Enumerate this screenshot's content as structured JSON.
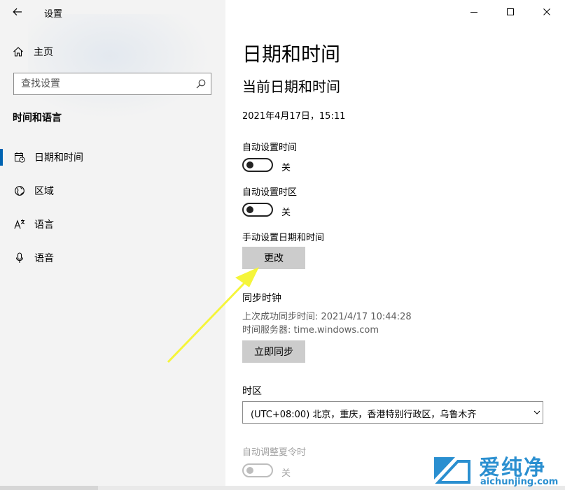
{
  "app": {
    "title": "设置"
  },
  "sidebar": {
    "home_label": "主页",
    "search_placeholder": "查找设置",
    "section_title": "时间和语言",
    "items": [
      {
        "label": "日期和时间",
        "icon": "calendar-clock-icon",
        "active": true
      },
      {
        "label": "区域",
        "icon": "globe-icon",
        "active": false
      },
      {
        "label": "语言",
        "icon": "language-icon",
        "active": false
      },
      {
        "label": "语音",
        "icon": "microphone-icon",
        "active": false
      }
    ]
  },
  "main": {
    "page_title": "日期和时间",
    "subtitle": "当前日期和时间",
    "current_datetime": "2021年4月17日，15:11",
    "auto_time": {
      "label": "自动设置时间",
      "state_text": "关"
    },
    "auto_timezone": {
      "label": "自动设置时区",
      "state_text": "关"
    },
    "manual": {
      "label": "手动设置日期和时间",
      "button": "更改"
    },
    "sync": {
      "heading": "同步时钟",
      "last_sync": "上次成功同步时间: 2021/4/17 10:44:28",
      "server": "时间服务器: time.windows.com",
      "button": "立即同步"
    },
    "timezone": {
      "label": "时区",
      "value": "(UTC+08:00) 北京，重庆，香港特别行政区，乌鲁木齐"
    },
    "dst": {
      "label": "自动调整夏令时",
      "state_text": "关"
    }
  },
  "watermark": {
    "cn": "爱纯净",
    "en": "aichunjing.com"
  },
  "colors": {
    "accent": "#0063b1",
    "annotation_arrow": "#f5f53a",
    "button_bg": "#cccccc",
    "watermark": "#2a8fd0"
  }
}
